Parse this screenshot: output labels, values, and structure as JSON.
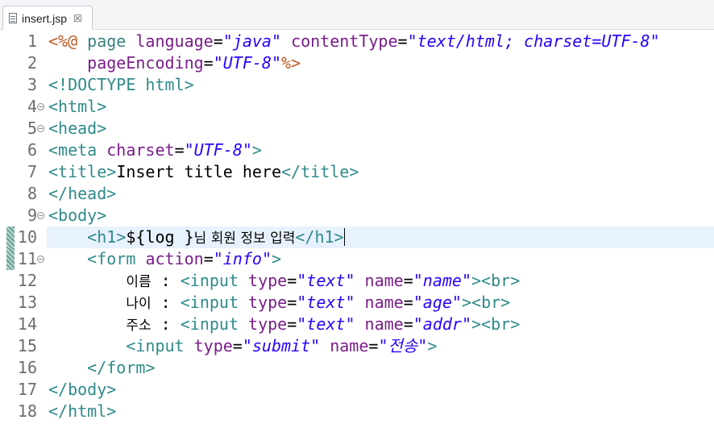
{
  "tab": {
    "filename": "insert.jsp",
    "close": "☒"
  },
  "lines": [
    {
      "n": "1",
      "fold": "",
      "segments": [
        {
          "t": "jsp",
          "v": "<%@ "
        },
        {
          "t": "jspkw",
          "v": "page "
        },
        {
          "t": "attr",
          "v": "language"
        },
        {
          "t": "text",
          "v": "="
        },
        {
          "t": "val",
          "v": "\"java\""
        },
        {
          "t": "text",
          "v": " "
        },
        {
          "t": "attr",
          "v": "contentType"
        },
        {
          "t": "text",
          "v": "="
        },
        {
          "t": "val",
          "v": "\"text/html; charset=UTF-8\""
        }
      ]
    },
    {
      "n": "2",
      "fold": "",
      "segments": [
        {
          "t": "text",
          "v": "    "
        },
        {
          "t": "attr",
          "v": "pageEncoding"
        },
        {
          "t": "text",
          "v": "="
        },
        {
          "t": "val",
          "v": "\"UTF-8\""
        },
        {
          "t": "jsp",
          "v": "%>"
        }
      ]
    },
    {
      "n": "3",
      "fold": "",
      "segments": [
        {
          "t": "delim",
          "v": "<!"
        },
        {
          "t": "tag",
          "v": "DOCTYPE html"
        },
        {
          "t": "delim",
          "v": ">"
        }
      ]
    },
    {
      "n": "4",
      "fold": "⊖",
      "segments": [
        {
          "t": "delim",
          "v": "<"
        },
        {
          "t": "tag",
          "v": "html"
        },
        {
          "t": "delim",
          "v": ">"
        }
      ]
    },
    {
      "n": "5",
      "fold": "⊖",
      "segments": [
        {
          "t": "delim",
          "v": "<"
        },
        {
          "t": "tag",
          "v": "head"
        },
        {
          "t": "delim",
          "v": ">"
        }
      ]
    },
    {
      "n": "6",
      "fold": "",
      "segments": [
        {
          "t": "delim",
          "v": "<"
        },
        {
          "t": "tag",
          "v": "meta "
        },
        {
          "t": "attr",
          "v": "charset"
        },
        {
          "t": "text",
          "v": "="
        },
        {
          "t": "val",
          "v": "\"UTF-8\""
        },
        {
          "t": "delim",
          "v": ">"
        }
      ]
    },
    {
      "n": "7",
      "fold": "",
      "segments": [
        {
          "t": "delim",
          "v": "<"
        },
        {
          "t": "tag",
          "v": "title"
        },
        {
          "t": "delim",
          "v": ">"
        },
        {
          "t": "text",
          "v": "Insert title here"
        },
        {
          "t": "delim",
          "v": "</"
        },
        {
          "t": "tag",
          "v": "title"
        },
        {
          "t": "delim",
          "v": ">"
        }
      ]
    },
    {
      "n": "8",
      "fold": "",
      "segments": [
        {
          "t": "delim",
          "v": "</"
        },
        {
          "t": "tag",
          "v": "head"
        },
        {
          "t": "delim",
          "v": ">"
        }
      ]
    },
    {
      "n": "9",
      "fold": "⊖",
      "segments": [
        {
          "t": "delim",
          "v": "<"
        },
        {
          "t": "tag",
          "v": "body"
        },
        {
          "t": "delim",
          "v": ">"
        }
      ]
    },
    {
      "n": "10",
      "fold": "",
      "current": true,
      "ruler": true,
      "segments": [
        {
          "t": "text",
          "v": "    "
        },
        {
          "t": "delim",
          "v": "<"
        },
        {
          "t": "tag",
          "v": "h1"
        },
        {
          "t": "delim",
          "v": ">"
        },
        {
          "t": "text",
          "v": "${log }"
        },
        {
          "t": "kor",
          "v": "님 회원 정보 입력"
        },
        {
          "t": "delim",
          "v": "</"
        },
        {
          "t": "tag",
          "v": "h1"
        },
        {
          "t": "delim",
          "v": ">"
        },
        {
          "t": "caret",
          "v": ""
        }
      ]
    },
    {
      "n": "11",
      "fold": "⊖",
      "ruler": true,
      "segments": [
        {
          "t": "text",
          "v": "    "
        },
        {
          "t": "delim",
          "v": "<"
        },
        {
          "t": "tag",
          "v": "form "
        },
        {
          "t": "attr",
          "v": "action"
        },
        {
          "t": "text",
          "v": "="
        },
        {
          "t": "val",
          "v": "\"info\""
        },
        {
          "t": "delim",
          "v": ">"
        }
      ]
    },
    {
      "n": "12",
      "fold": "",
      "segments": [
        {
          "t": "text",
          "v": "        "
        },
        {
          "t": "kor",
          "v": "이름"
        },
        {
          "t": "text",
          "v": " : "
        },
        {
          "t": "delim",
          "v": "<"
        },
        {
          "t": "tag",
          "v": "input "
        },
        {
          "t": "attr",
          "v": "type"
        },
        {
          "t": "text",
          "v": "="
        },
        {
          "t": "val",
          "v": "\"text\""
        },
        {
          "t": "text",
          "v": " "
        },
        {
          "t": "attr",
          "v": "name"
        },
        {
          "t": "text",
          "v": "="
        },
        {
          "t": "val",
          "v": "\"name\""
        },
        {
          "t": "delim",
          "v": "><"
        },
        {
          "t": "tag",
          "v": "br"
        },
        {
          "t": "delim",
          "v": ">"
        }
      ]
    },
    {
      "n": "13",
      "fold": "",
      "segments": [
        {
          "t": "text",
          "v": "        "
        },
        {
          "t": "kor",
          "v": "나이"
        },
        {
          "t": "text",
          "v": " : "
        },
        {
          "t": "delim",
          "v": "<"
        },
        {
          "t": "tag",
          "v": "input "
        },
        {
          "t": "attr",
          "v": "type"
        },
        {
          "t": "text",
          "v": "="
        },
        {
          "t": "val",
          "v": "\"text\""
        },
        {
          "t": "text",
          "v": " "
        },
        {
          "t": "attr",
          "v": "name"
        },
        {
          "t": "text",
          "v": "="
        },
        {
          "t": "val",
          "v": "\"age\""
        },
        {
          "t": "delim",
          "v": "><"
        },
        {
          "t": "tag",
          "v": "br"
        },
        {
          "t": "delim",
          "v": ">"
        }
      ]
    },
    {
      "n": "14",
      "fold": "",
      "segments": [
        {
          "t": "text",
          "v": "        "
        },
        {
          "t": "kor",
          "v": "주소"
        },
        {
          "t": "text",
          "v": " : "
        },
        {
          "t": "delim",
          "v": "<"
        },
        {
          "t": "tag",
          "v": "input "
        },
        {
          "t": "attr",
          "v": "type"
        },
        {
          "t": "text",
          "v": "="
        },
        {
          "t": "val",
          "v": "\"text\""
        },
        {
          "t": "text",
          "v": " "
        },
        {
          "t": "attr",
          "v": "name"
        },
        {
          "t": "text",
          "v": "="
        },
        {
          "t": "val",
          "v": "\"addr\""
        },
        {
          "t": "delim",
          "v": "><"
        },
        {
          "t": "tag",
          "v": "br"
        },
        {
          "t": "delim",
          "v": ">"
        }
      ]
    },
    {
      "n": "15",
      "fold": "",
      "segments": [
        {
          "t": "text",
          "v": "        "
        },
        {
          "t": "delim",
          "v": "<"
        },
        {
          "t": "tag",
          "v": "input "
        },
        {
          "t": "attr",
          "v": "type"
        },
        {
          "t": "text",
          "v": "="
        },
        {
          "t": "val",
          "v": "\"submit\""
        },
        {
          "t": "text",
          "v": " "
        },
        {
          "t": "attr",
          "v": "name"
        },
        {
          "t": "text",
          "v": "="
        },
        {
          "t": "val",
          "v": "\"전송\""
        },
        {
          "t": "delim",
          "v": ">"
        }
      ]
    },
    {
      "n": "16",
      "fold": "",
      "segments": [
        {
          "t": "text",
          "v": "    "
        },
        {
          "t": "delim",
          "v": "</"
        },
        {
          "t": "tag",
          "v": "form"
        },
        {
          "t": "delim",
          "v": ">"
        }
      ]
    },
    {
      "n": "17",
      "fold": "",
      "segments": [
        {
          "t": "delim",
          "v": "</"
        },
        {
          "t": "tag",
          "v": "body"
        },
        {
          "t": "delim",
          "v": ">"
        }
      ]
    },
    {
      "n": "18",
      "fold": "",
      "segments": [
        {
          "t": "delim",
          "v": "</"
        },
        {
          "t": "tag",
          "v": "html"
        },
        {
          "t": "delim",
          "v": ">"
        }
      ]
    }
  ]
}
